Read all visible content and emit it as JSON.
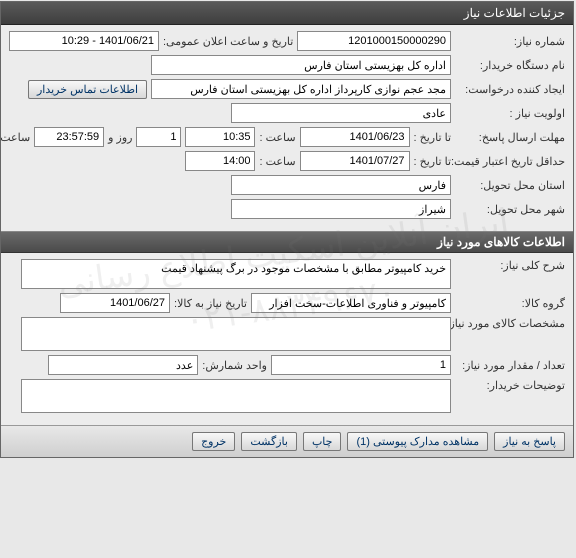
{
  "window": {
    "title": "جزئیات اطلاعات نیاز"
  },
  "section1": {
    "need_no_label": "شماره نیاز:",
    "need_no": "1201000150000290",
    "announce_label": "تاریخ و ساعت اعلان عمومی:",
    "announce_value": "1401/06/21 - 10:29",
    "buyer_label": "نام دستگاه خریدار:",
    "buyer_value": "اداره کل بهزیستی استان فارس",
    "requester_label": "ایجاد کننده درخواست:",
    "requester_value": "مجد عجم نوازی کارپرداز اداره کل بهزیستی استان فارس",
    "contact_btn": "اطلاعات تماس خریدار",
    "priority_label": "اولویت نیاز :",
    "priority_value": "عادی",
    "deadline_label": "مهلت ارسال پاسخ:",
    "to_date_label": "تا تاریخ :",
    "deadline_date": "1401/06/23",
    "time_label": "ساعت :",
    "deadline_time": "10:35",
    "days_count": "1",
    "days_and": "روز و",
    "remaining_time": "23:57:59",
    "remaining_label": "ساعت باقی مانده",
    "price_validity_label": "حداقل تاریخ اعتبار قیمت:",
    "price_validity_date": "1401/07/27",
    "price_validity_time": "14:00",
    "province_label": "استان محل تحویل:",
    "province_value": "فارس",
    "city_label": "شهر محل تحویل:",
    "city_value": "شیراز"
  },
  "section2": {
    "header": "اطلاعات کالاهای مورد نیاز",
    "desc_label": "شرح کلی نیاز:",
    "desc_value": "خرید کامپیوتر مطابق با مشخصات موجود در برگ پیشنهاد قیمت",
    "group_label": "گروه کالا:",
    "group_value": "کامپیوتر و فناوری اطلاعات-سخت افزار",
    "need_date_label": "تاریخ نیاز به کالا:",
    "need_date_value": "1401/06/27",
    "spec_label": "مشخصات کالای مورد نیاز:",
    "qty_label": "تعداد / مقدار مورد نیاز:",
    "qty_value": "1",
    "unit_label": "واحد شمارش:",
    "unit_value": "عدد",
    "buyer_notes_label": "توضیحات خریدار:"
  },
  "footer": {
    "respond": "پاسخ به نیاز",
    "attachments": "مشاهده مدارک پیوستی (1)",
    "print": "چاپ",
    "back": "بازگشت",
    "exit": "خروج"
  },
  "watermark": {
    "line1": "ایران آنلاین اسکیت اطلاع رسانی",
    "line2": "۰۲۱-۸۸۳۴۹۶۷۰"
  }
}
